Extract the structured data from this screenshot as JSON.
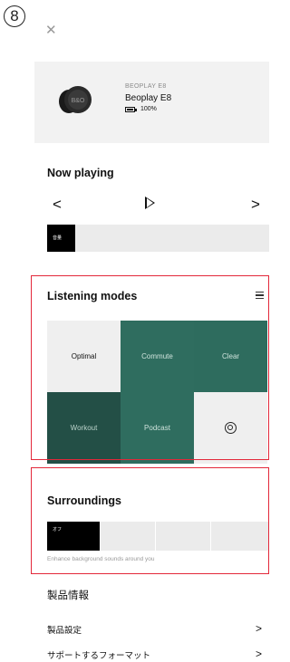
{
  "step_number": "8",
  "device": {
    "brand": "BEOPLAY E8",
    "name": "Beoplay E8",
    "battery": "100%",
    "earbud_logo": "B&O"
  },
  "now_playing": {
    "title": "Now playing",
    "prev": "<",
    "next": ">",
    "volume_label": "音量"
  },
  "listening_modes": {
    "title": "Listening modes",
    "modes": [
      "Optimal",
      "Commute",
      "Clear",
      "Workout",
      "Podcast"
    ]
  },
  "surroundings": {
    "title": "Surroundings",
    "selected_label": "オフ",
    "caption": "Enhance background sounds around you"
  },
  "product_info": {
    "title": "製品情報",
    "items": [
      "製品設定",
      "サポートするフォーマット"
    ],
    "chevron": ">"
  },
  "colors": {
    "teal": "#2f6d5f",
    "dark_teal": "#234f46",
    "highlight": "#e3283a"
  }
}
